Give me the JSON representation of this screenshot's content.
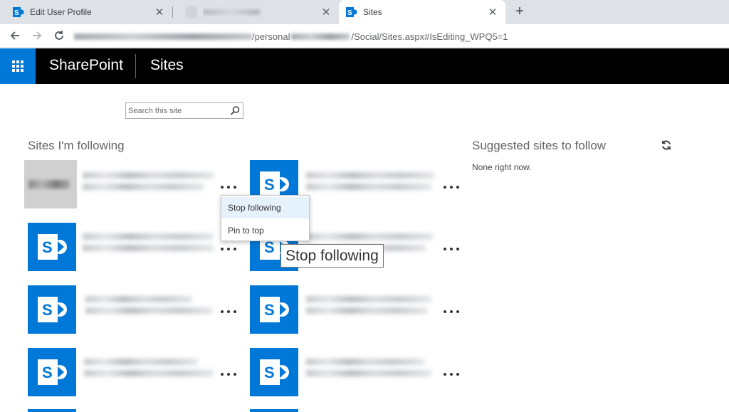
{
  "browser": {
    "tabs": [
      {
        "title": "Edit User Profile",
        "active": false
      },
      {
        "title": "",
        "active": false
      },
      {
        "title": "Sites",
        "active": true
      }
    ],
    "address": {
      "visible_text": "/personal",
      "visible_text_2": "/Social/Sites.aspx#IsEditing_WPQ5=1"
    }
  },
  "suitebar": {
    "brand": "SharePoint",
    "title": "Sites"
  },
  "search": {
    "placeholder": "Search this site"
  },
  "following": {
    "heading": "Sites I'm following",
    "sites": [
      {
        "column": 1,
        "row": 1,
        "icon": "blurred-site-logo"
      },
      {
        "column": 2,
        "row": 1,
        "icon": "sharepoint-site-icon"
      },
      {
        "column": 1,
        "row": 2,
        "icon": "sharepoint-site-icon"
      },
      {
        "column": 2,
        "row": 2,
        "icon": "sharepoint-site-icon"
      },
      {
        "column": 1,
        "row": 3,
        "icon": "sharepoint-site-icon"
      },
      {
        "column": 2,
        "row": 3,
        "icon": "sharepoint-site-icon"
      },
      {
        "column": 1,
        "row": 4,
        "icon": "sharepoint-site-icon"
      },
      {
        "column": 2,
        "row": 4,
        "icon": "sharepoint-site-icon"
      }
    ]
  },
  "suggested": {
    "heading": "Suggested sites to follow",
    "none_text": "None right now."
  },
  "context_menu": {
    "items": [
      {
        "label": "Stop following"
      },
      {
        "label": "Pin to top"
      }
    ]
  },
  "tooltip": {
    "text": "Stop following"
  },
  "colors": {
    "accent": "#0078d7",
    "suitebar": "#000000",
    "menu_hover": "#e6f2fb"
  }
}
